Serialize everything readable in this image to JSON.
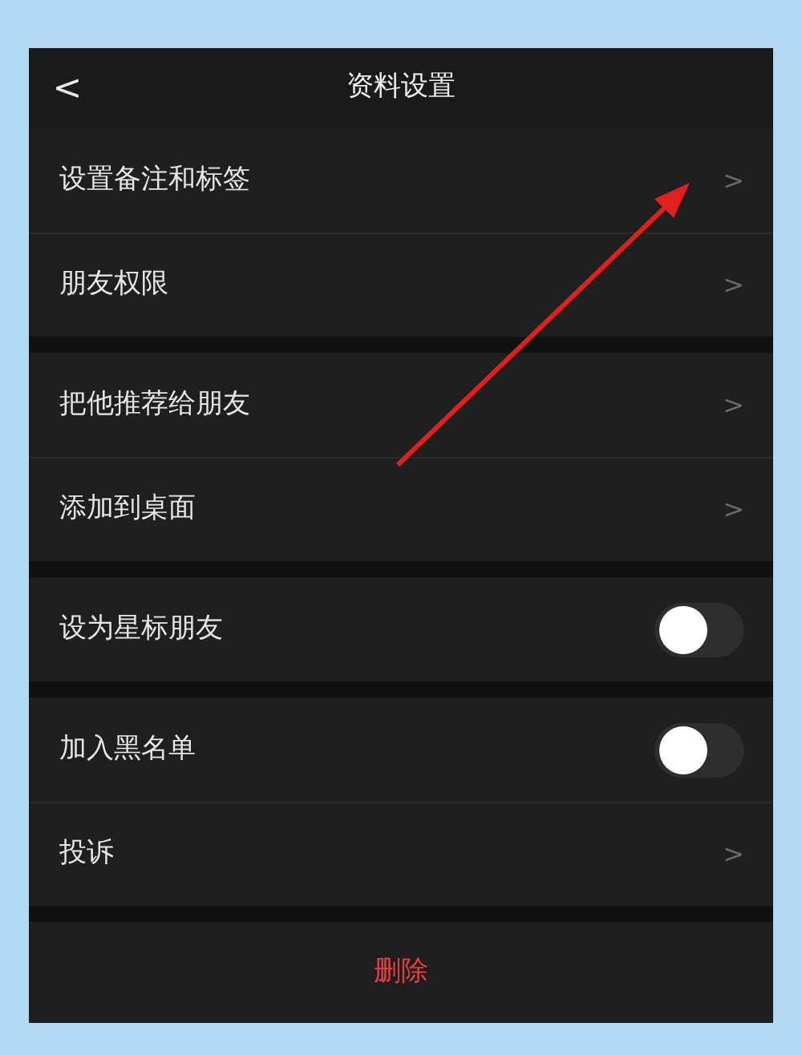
{
  "header": {
    "back": "<",
    "title": "资料设置"
  },
  "groups": [
    [
      {
        "kind": "link",
        "label": "设置备注和标签",
        "chevron": ">"
      },
      {
        "kind": "link",
        "label": "朋友权限",
        "chevron": ">"
      }
    ],
    [
      {
        "kind": "link",
        "label": "把他推荐给朋友",
        "chevron": ">"
      },
      {
        "kind": "link",
        "label": "添加到桌面",
        "chevron": ">"
      }
    ],
    [
      {
        "kind": "toggle",
        "label": "设为星标朋友",
        "on": false
      }
    ],
    [
      {
        "kind": "toggle",
        "label": "加入黑名单",
        "on": false
      },
      {
        "kind": "link",
        "label": "投诉",
        "chevron": ">"
      }
    ]
  ],
  "delete_button": "删除"
}
